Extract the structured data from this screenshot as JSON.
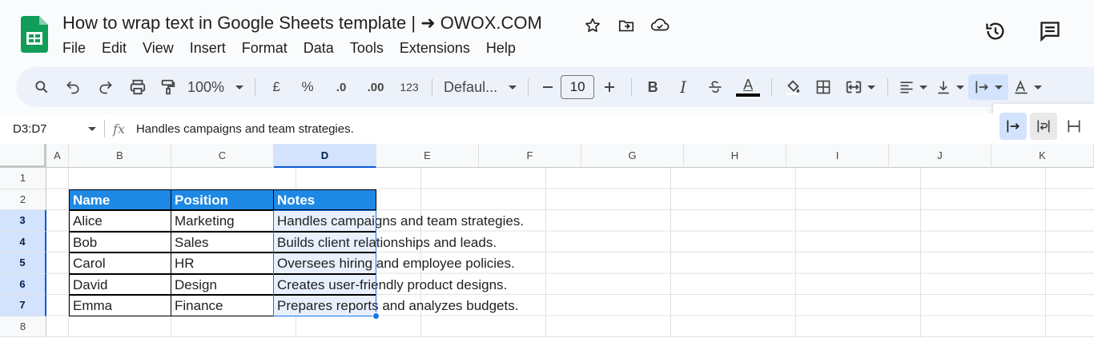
{
  "doc": {
    "title": "How to wrap text in Google Sheets template | ➜ OWOX.COM"
  },
  "menu": [
    "File",
    "Edit",
    "View",
    "Insert",
    "Format",
    "Data",
    "Tools",
    "Extensions",
    "Help"
  ],
  "toolbar": {
    "zoom": "100%",
    "currency": "£",
    "percent": "%",
    "dec_decrease": ".0",
    "dec_increase": ".00",
    "number_format": "123",
    "font": "Defaul...",
    "font_size": "10",
    "bold": "B",
    "italic": "I",
    "text_color_letter": "A"
  },
  "formula_bar": {
    "name_box": "D3:D7",
    "fx": "fx",
    "content": "Handles campaigns and team strategies."
  },
  "columns": [
    "A",
    "B",
    "C",
    "D",
    "E",
    "F",
    "G",
    "H",
    "I",
    "J",
    "K"
  ],
  "rows": [
    "1",
    "2",
    "3",
    "4",
    "5",
    "6",
    "7",
    "8"
  ],
  "table": {
    "headers": [
      "Name",
      "Position",
      "Notes"
    ],
    "data": [
      [
        "Alice",
        "Marketing",
        "Handles campaigns and team strategies."
      ],
      [
        "Bob",
        "Sales",
        "Builds client relationships and leads."
      ],
      [
        "Carol",
        "HR",
        "Oversees hiring and employee policies."
      ],
      [
        "David",
        "Design",
        "Creates user-friendly product designs."
      ],
      [
        "Emma",
        "Finance",
        "Prepares reports and analyzes budgets."
      ]
    ]
  },
  "colors": {
    "header_fill": "#1e88e5",
    "selection": "#1a73e8",
    "toolbar_bg": "#edf2fa"
  }
}
